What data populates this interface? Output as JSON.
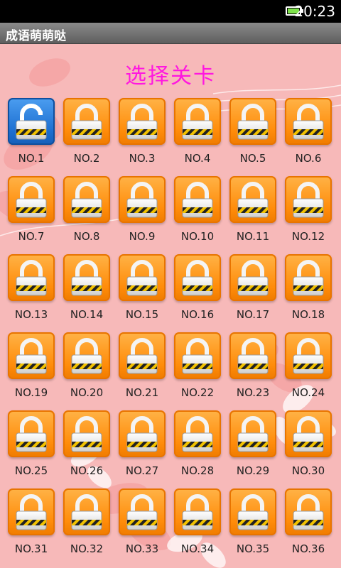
{
  "status_bar": {
    "time": "20:23",
    "battery_icon": "battery-full-icon"
  },
  "title_bar": {
    "title": "成语萌萌哒"
  },
  "page": {
    "heading": "选择关卡"
  },
  "colors": {
    "heading": "#ff17e0",
    "locked_tile": "#ff8c0a",
    "unlocked_tile": "#1d6fd1",
    "background": "#f7b9b9"
  },
  "levels": [
    {
      "label": "NO.1",
      "state": "unlocked",
      "icon": "unlocked-padlock-icon"
    },
    {
      "label": "NO.2",
      "state": "locked",
      "icon": "padlock-icon"
    },
    {
      "label": "NO.3",
      "state": "locked",
      "icon": "padlock-icon"
    },
    {
      "label": "NO.4",
      "state": "locked",
      "icon": "padlock-icon"
    },
    {
      "label": "NO.5",
      "state": "locked",
      "icon": "padlock-icon"
    },
    {
      "label": "NO.6",
      "state": "locked",
      "icon": "padlock-icon"
    },
    {
      "label": "NO.7",
      "state": "locked",
      "icon": "padlock-icon"
    },
    {
      "label": "NO.8",
      "state": "locked",
      "icon": "padlock-icon"
    },
    {
      "label": "NO.9",
      "state": "locked",
      "icon": "padlock-icon"
    },
    {
      "label": "NO.10",
      "state": "locked",
      "icon": "padlock-icon"
    },
    {
      "label": "NO.11",
      "state": "locked",
      "icon": "padlock-icon"
    },
    {
      "label": "NO.12",
      "state": "locked",
      "icon": "padlock-icon"
    },
    {
      "label": "NO.13",
      "state": "locked",
      "icon": "padlock-icon"
    },
    {
      "label": "NO.14",
      "state": "locked",
      "icon": "padlock-icon"
    },
    {
      "label": "NO.15",
      "state": "locked",
      "icon": "padlock-icon"
    },
    {
      "label": "NO.16",
      "state": "locked",
      "icon": "padlock-icon"
    },
    {
      "label": "NO.17",
      "state": "locked",
      "icon": "padlock-icon"
    },
    {
      "label": "NO.18",
      "state": "locked",
      "icon": "padlock-icon"
    },
    {
      "label": "NO.19",
      "state": "locked",
      "icon": "padlock-icon"
    },
    {
      "label": "NO.20",
      "state": "locked",
      "icon": "padlock-icon"
    },
    {
      "label": "NO.21",
      "state": "locked",
      "icon": "padlock-icon"
    },
    {
      "label": "NO.22",
      "state": "locked",
      "icon": "padlock-icon"
    },
    {
      "label": "NO.23",
      "state": "locked",
      "icon": "padlock-icon"
    },
    {
      "label": "NO.24",
      "state": "locked",
      "icon": "padlock-icon"
    },
    {
      "label": "NO.25",
      "state": "locked",
      "icon": "padlock-icon"
    },
    {
      "label": "NO.26",
      "state": "locked",
      "icon": "padlock-icon"
    },
    {
      "label": "NO.27",
      "state": "locked",
      "icon": "padlock-icon"
    },
    {
      "label": "NO.28",
      "state": "locked",
      "icon": "padlock-icon"
    },
    {
      "label": "NO.29",
      "state": "locked",
      "icon": "padlock-icon"
    },
    {
      "label": "NO.30",
      "state": "locked",
      "icon": "padlock-icon"
    },
    {
      "label": "NO.31",
      "state": "locked",
      "icon": "padlock-icon"
    },
    {
      "label": "NO.32",
      "state": "locked",
      "icon": "padlock-icon"
    },
    {
      "label": "NO.33",
      "state": "locked",
      "icon": "padlock-icon"
    },
    {
      "label": "NO.34",
      "state": "locked",
      "icon": "padlock-icon"
    },
    {
      "label": "NO.35",
      "state": "locked",
      "icon": "padlock-icon"
    },
    {
      "label": "NO.36",
      "state": "locked",
      "icon": "padlock-icon"
    }
  ]
}
